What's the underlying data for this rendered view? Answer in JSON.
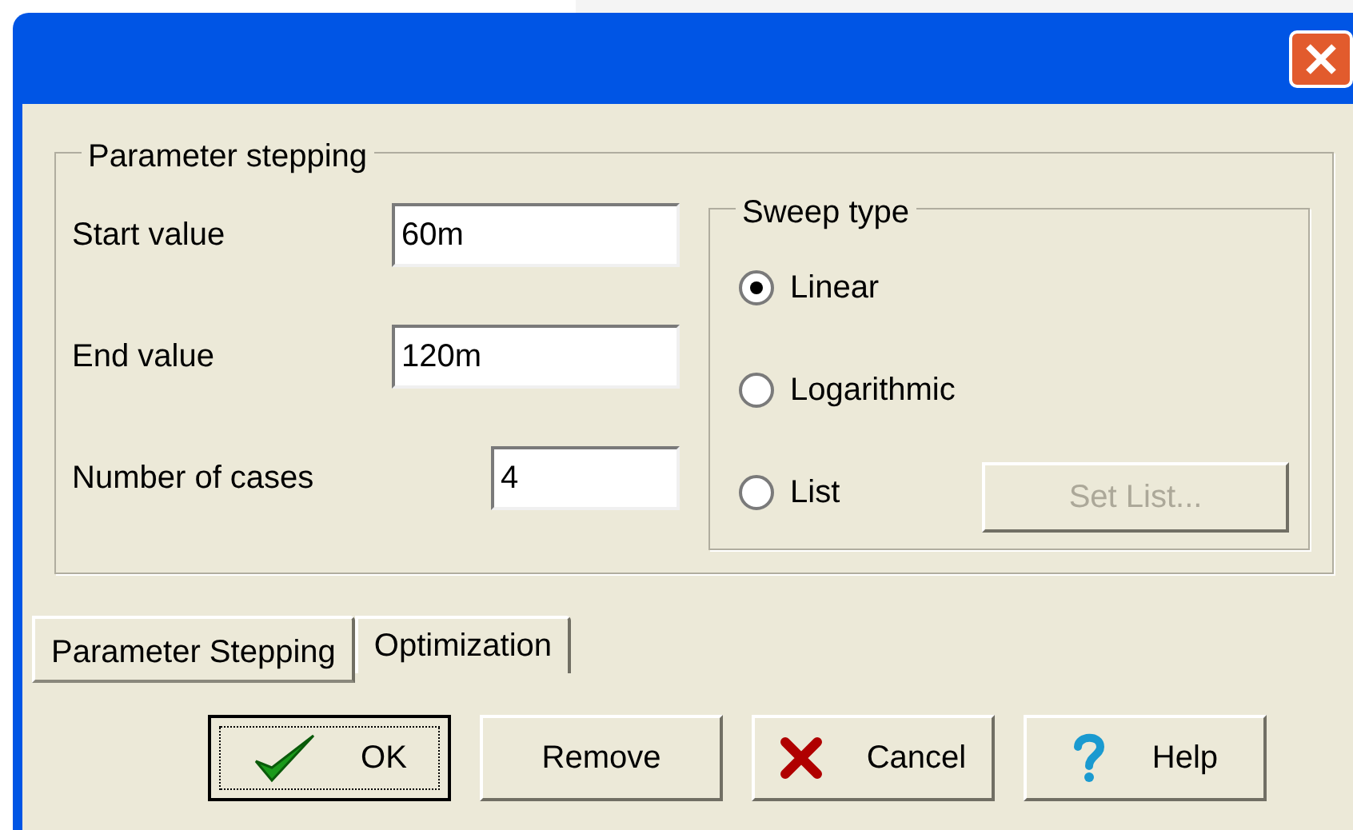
{
  "group": {
    "title": "Parameter stepping"
  },
  "fields": [
    {
      "label": "Start value",
      "value": "60m",
      "kind": "wide"
    },
    {
      "label": "End value",
      "value": "120m",
      "kind": "wide"
    },
    {
      "label": "Number of cases",
      "value": "4",
      "kind": "narrow"
    }
  ],
  "sweep_type": {
    "title": "Sweep type",
    "options": [
      {
        "label": "Linear",
        "selected": true
      },
      {
        "label": "Logarithmic",
        "selected": false
      },
      {
        "label": "List",
        "selected": false
      }
    ],
    "set_list_button": {
      "label": "Set List...",
      "disabled": true
    }
  },
  "tabs": [
    {
      "label": "Parameter Stepping",
      "selected": true
    },
    {
      "label": "Optimization",
      "selected": false
    }
  ],
  "buttons": [
    {
      "label": "OK",
      "kind": "ok",
      "default": true
    },
    {
      "label": "Remove",
      "kind": "plain",
      "default": false
    },
    {
      "label": "Cancel",
      "kind": "cancel",
      "default": false
    },
    {
      "label": "Help",
      "kind": "help",
      "default": false
    }
  ]
}
